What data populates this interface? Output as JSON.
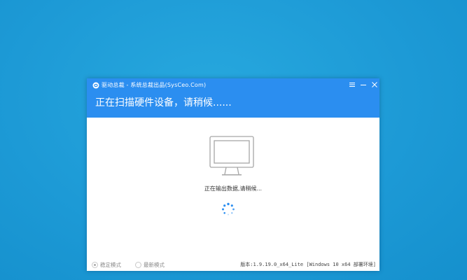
{
  "window": {
    "app_name": "驱动总裁 - 系统总裁出品(SysCeo.Com)",
    "heading": "正在扫描硬件设备，请稍候......",
    "status_text": "正在输出数据,请稍候...",
    "accent_color": "#2b8ef0",
    "icons": {
      "app": "driver-logo-icon",
      "menu": "menu-icon",
      "minimize": "minimize-icon",
      "close": "close-icon",
      "monitor": "monitor-icon",
      "spinner": "loading-spinner-icon"
    }
  },
  "footer": {
    "mode_stable": "稳定模式",
    "mode_latest": "最新模式",
    "selected_mode": "stable",
    "version": "版本:1.9.19.0_x64_Lite [Windows 10 x64 部署环境]"
  }
}
